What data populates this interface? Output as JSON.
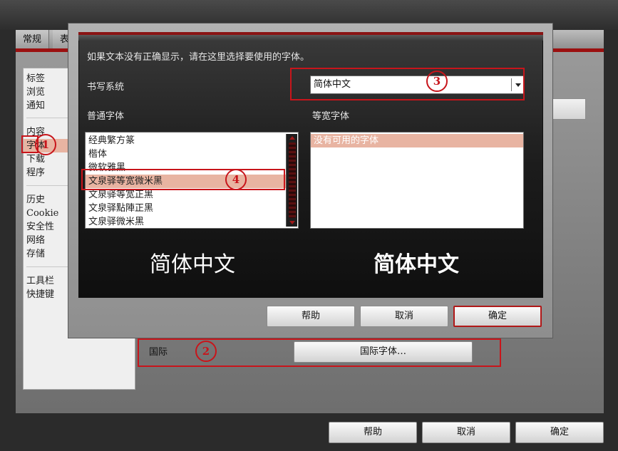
{
  "settings": {
    "tabs": [
      "常规",
      "表"
    ],
    "sidebar": [
      {
        "label": "标签",
        "selected": false
      },
      {
        "label": "浏览",
        "selected": false
      },
      {
        "label": "通知",
        "selected": false
      },
      {
        "label": "内容",
        "selected": false
      },
      {
        "label": "字体",
        "selected": true
      },
      {
        "label": "下载",
        "selected": false
      },
      {
        "label": "程序",
        "selected": false
      },
      {
        "label": "历史",
        "selected": false
      },
      {
        "label": "Cookie",
        "selected": false
      },
      {
        "label": "安全性",
        "selected": false
      },
      {
        "label": "网络",
        "selected": false
      },
      {
        "label": "存储",
        "selected": false
      },
      {
        "label": "工具栏",
        "selected": false
      },
      {
        "label": "快捷键",
        "selected": false
      }
    ],
    "intl_label": "国际",
    "intl_button": "国际字体…",
    "buttons": {
      "help": "帮助",
      "cancel": "取消",
      "ok": "确定"
    }
  },
  "dialog": {
    "instruction": "如果文本没有正确显示，请在这里选择要使用的字体。",
    "writing_system_label": "书写系统",
    "writing_system_value": "简体中文",
    "normal_font_label": "普通字体",
    "mono_font_label": "等宽字体",
    "normal_fonts": [
      {
        "label": "经典繁方篆",
        "selected": false
      },
      {
        "label": "楷体",
        "selected": false
      },
      {
        "label": "微软雅黑",
        "selected": false
      },
      {
        "label": "文泉驿等宽微米黑",
        "selected": true
      },
      {
        "label": "文泉驿等宽正黑",
        "selected": false
      },
      {
        "label": "文泉驿點陣正黑",
        "selected": false
      },
      {
        "label": "文泉驿微米黑",
        "selected": false
      }
    ],
    "mono_fonts": [
      {
        "label": "没有可用的字体",
        "selected": true
      }
    ],
    "preview_normal": "简体中文",
    "preview_mono": "简体中文",
    "buttons": {
      "help": "帮助",
      "cancel": "取消",
      "ok": "确定"
    }
  },
  "callouts": [
    "1",
    "2",
    "3",
    "4"
  ],
  "colors": {
    "accent_red": "#c8151b",
    "selection": "#e8b4a2"
  }
}
